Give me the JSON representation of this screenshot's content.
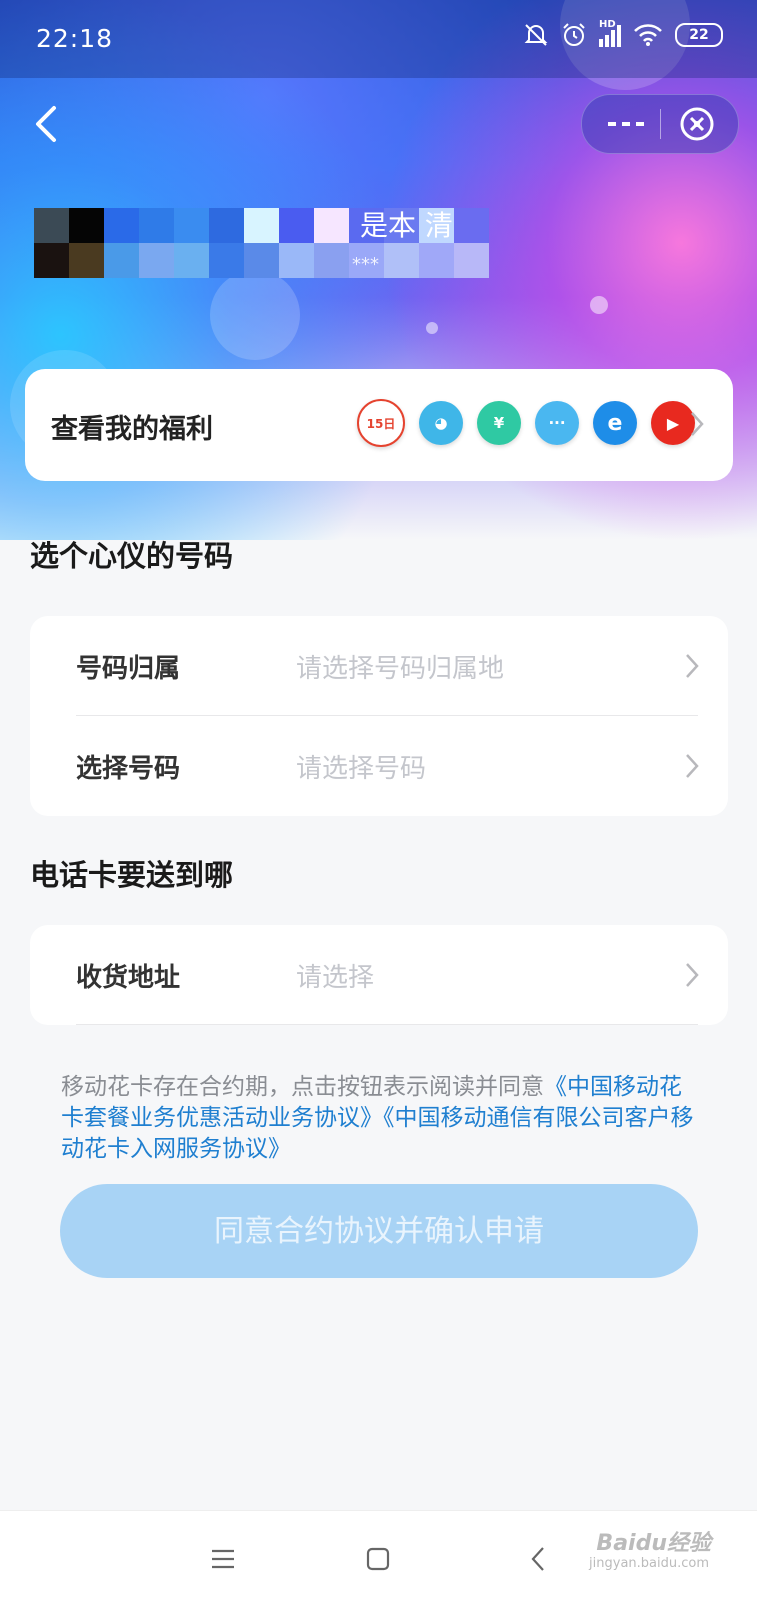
{
  "status_bar": {
    "time": "22:18",
    "network": "HD",
    "battery": "22"
  },
  "header": {
    "back_icon": "chevron-left-icon",
    "more_icon": "more-icon",
    "close_icon": "close-circle-icon"
  },
  "profile": {
    "name_visible": "是本  清",
    "sub_visible": "***"
  },
  "benefits": {
    "title": "查看我的福利",
    "icons": [
      {
        "name": "calendar-15-icon",
        "label": "15日",
        "color": "#ffffff",
        "text_color": "#e5432f"
      },
      {
        "name": "hand-icon",
        "label": "◕",
        "color": "#3fb6e8"
      },
      {
        "name": "yen-icon",
        "label": "¥",
        "color": "#2fc9a3"
      },
      {
        "name": "message-icon",
        "label": "···",
        "color": "#4ab7f0"
      },
      {
        "name": "e-logo-icon",
        "label": "e",
        "color": "#1e8de8"
      },
      {
        "name": "video-play-icon",
        "label": "▶",
        "color": "#e8291f"
      }
    ]
  },
  "number_section": {
    "title": "选个心仪的号码",
    "rows": [
      {
        "label": "号码归属",
        "placeholder": "请选择号码归属地"
      },
      {
        "label": "选择号码",
        "placeholder": "请选择号码"
      }
    ]
  },
  "delivery_section": {
    "title": "电话卡要送到哪",
    "rows": [
      {
        "label": "收货地址",
        "placeholder": "请选择"
      }
    ]
  },
  "agreement": {
    "prefix": "移动花卡存在合约期，点击按钮表示阅读并同意",
    "link1": "《中国移动花卡套餐业务优惠活动业务协议》",
    "link2": "《中国移动通信有限公司客户移动花卡入网服务协议》"
  },
  "confirm_button": "同意合约协议并确认申请",
  "nav_bar": {
    "menu_icon": "menu-icon",
    "home_icon": "home-square-icon",
    "back_icon": "back-triangle-icon"
  },
  "watermark": {
    "text": "Baidu经验",
    "sub": "jingyan.baidu.com"
  },
  "colors": {
    "accent": "#1f7fd0",
    "button_disabled": "#a8d3f5",
    "placeholder": "#c4c6cc"
  }
}
